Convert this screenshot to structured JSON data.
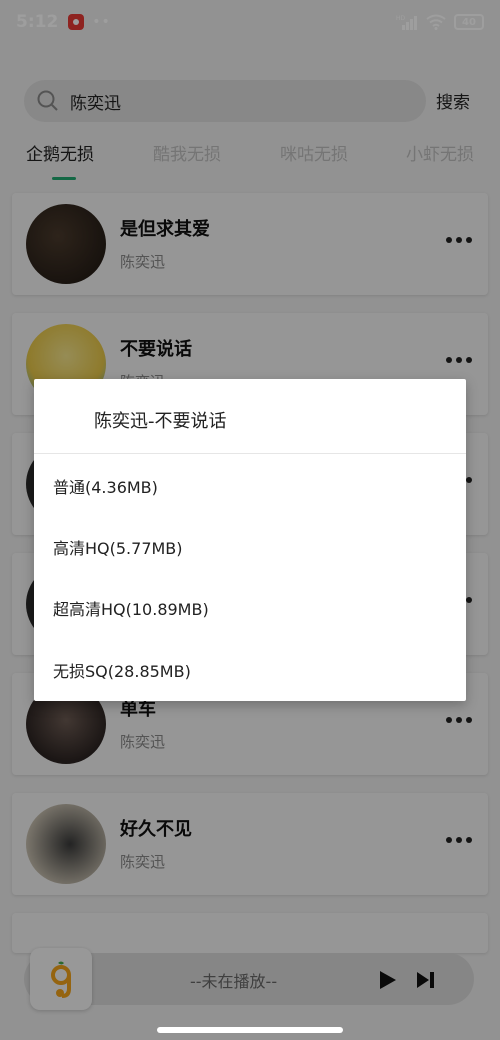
{
  "status_bar": {
    "time": "5:12",
    "dots": "••",
    "battery": "40",
    "network": "HD"
  },
  "search": {
    "query": "陈奕迅",
    "placeholder": "",
    "button": "搜索"
  },
  "tabs": [
    {
      "label": "企鹅无损",
      "active": true
    },
    {
      "label": "酷我无损",
      "active": false
    },
    {
      "label": "咪咕无损",
      "active": false
    },
    {
      "label": "小虾无损",
      "active": false
    }
  ],
  "songs": [
    {
      "title": "是但求其爱",
      "artist": "陈奕迅"
    },
    {
      "title": "不要说话",
      "artist": "陈奕迅"
    },
    {
      "title": "",
      "artist": ""
    },
    {
      "title": "",
      "artist": ""
    },
    {
      "title": "单车",
      "artist": "陈奕迅"
    },
    {
      "title": "好久不见",
      "artist": "陈奕迅"
    }
  ],
  "dialog": {
    "title": "陈奕迅-不要说话",
    "options": [
      {
        "label": "普通(4.36MB)"
      },
      {
        "label": "高清HQ(5.77MB)"
      },
      {
        "label": "超高清HQ(10.89MB)"
      },
      {
        "label": "无损SQ(28.85MB)"
      }
    ]
  },
  "player": {
    "status": "--未在播放--"
  },
  "colors": {
    "accent": "#21a870",
    "scrim": "rgba(0,0,0,0.38)"
  }
}
